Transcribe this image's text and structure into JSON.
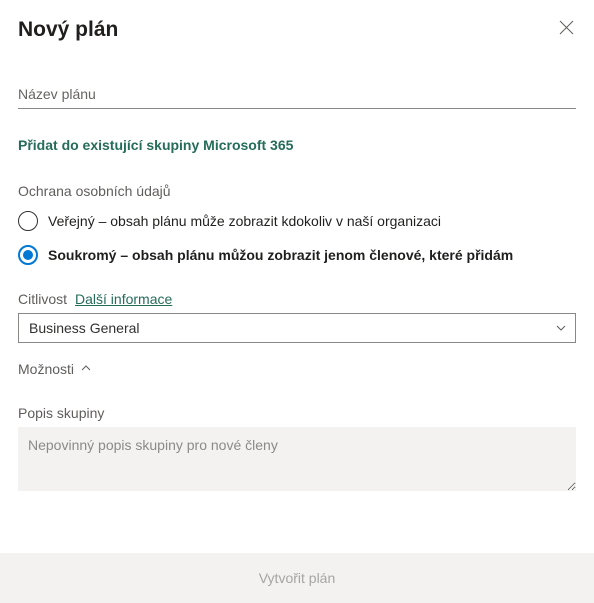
{
  "header": {
    "title": "Nový plán"
  },
  "planName": {
    "placeholder": "Název plánu",
    "value": ""
  },
  "addGroupLink": "Přidat do existující skupiny Microsoft 365",
  "privacy": {
    "sectionLabel": "Ochrana osobních údajů",
    "options": [
      {
        "label": "Veřejný – obsah plánu může zobrazit kdokoliv v naší organizaci",
        "selected": false
      },
      {
        "label": "Soukromý – obsah plánu můžou zobrazit jenom členové, které přidám",
        "selected": true
      }
    ]
  },
  "sensitivity": {
    "label": "Citlivost",
    "learnMore": "Další informace",
    "value": "Business General"
  },
  "optionsToggle": "Možnosti",
  "description": {
    "label": "Popis skupiny",
    "placeholder": "Nepovinný popis skupiny pro nové členy",
    "value": ""
  },
  "footer": {
    "createButton": "Vytvořit plán"
  }
}
